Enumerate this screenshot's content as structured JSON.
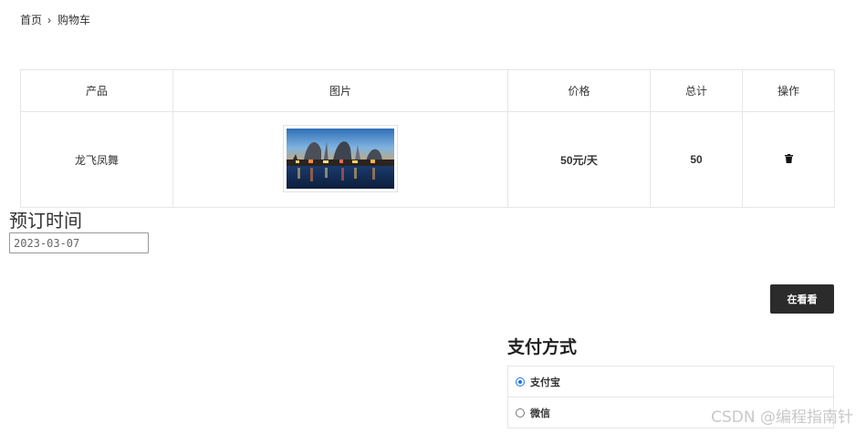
{
  "breadcrumb": {
    "home": "首页",
    "separator": "›",
    "current": "购物车"
  },
  "cart_table": {
    "headers": {
      "product": "产品",
      "image": "图片",
      "price": "价格",
      "total": "总计",
      "action": "操作"
    },
    "row": {
      "product": "龙飞凤舞",
      "image_icon": "theme-park-photo",
      "price": "50元/天",
      "total": "50",
      "delete_icon": "trash-icon"
    }
  },
  "reservation": {
    "label": "预订时间",
    "date_value": "2023-03-07"
  },
  "buttons": {
    "see": "在看看"
  },
  "payment": {
    "title": "支付方式",
    "options": [
      {
        "label": "支付宝",
        "selected": true
      },
      {
        "label": "微信",
        "selected": false
      }
    ]
  },
  "watermark": "CSDN @编程指南针",
  "colors": {
    "button_bg": "#2b2b2b",
    "radio_accent": "#1a73e8",
    "border": "#e6e6e6"
  }
}
